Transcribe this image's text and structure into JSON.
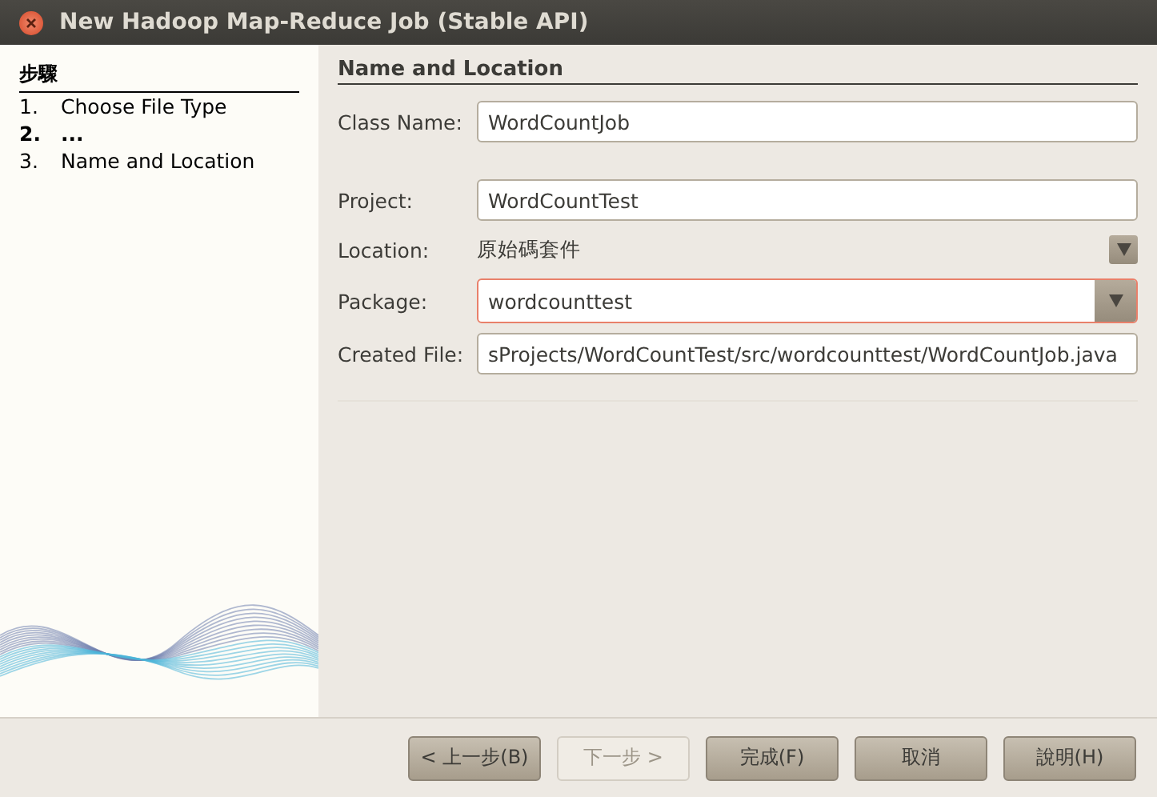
{
  "window": {
    "title": "New Hadoop Map-Reduce Job (Stable API)"
  },
  "steps": {
    "heading": "步驟",
    "items": [
      {
        "number": "1.",
        "label": "Choose File Type",
        "selected": false
      },
      {
        "number": "2.",
        "label": "...",
        "selected": true
      },
      {
        "number": "3.",
        "label": "Name and Location",
        "selected": false
      }
    ]
  },
  "panel": {
    "heading": "Name and Location",
    "fields": [
      {
        "kind": "text",
        "label": "Class Name:",
        "value": "WordCountJob",
        "focused": false
      },
      {
        "kind": "text",
        "label": "Project:",
        "value": "WordCountTest",
        "focused": false
      },
      {
        "kind": "static",
        "label": "Location:",
        "value": "原始碼套件"
      },
      {
        "kind": "combo",
        "label": "Package:",
        "value": "wordcounttest",
        "focused": true
      },
      {
        "kind": "text",
        "label": "Created File:",
        "value": "sProjects/WordCountTest/src/wordcounttest/WordCountJob.java",
        "focused": false
      }
    ]
  },
  "buttons": [
    {
      "label": "< 上一步(B)",
      "disabled": false
    },
    {
      "label": "下一步 >",
      "disabled": true
    },
    {
      "label": "完成(F)",
      "disabled": false
    },
    {
      "label": "取消",
      "disabled": false
    },
    {
      "label": "說明(H)",
      "disabled": false
    }
  ]
}
